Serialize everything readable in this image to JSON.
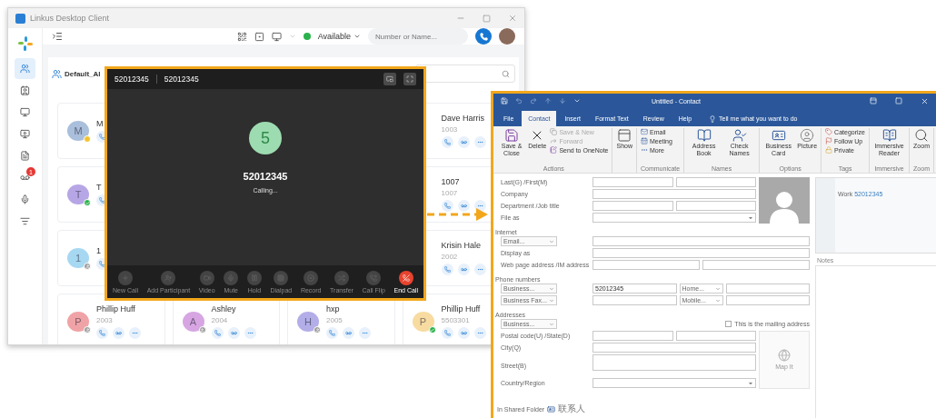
{
  "linkus": {
    "title": "Linkus Desktop Client",
    "sidebar": [
      {
        "selected": true
      },
      {
        "selected": false
      },
      {
        "selected": false
      },
      {
        "selected": false
      },
      {
        "selected": false
      },
      {
        "selected": false,
        "badge": "1"
      },
      {
        "selected": false
      },
      {
        "selected": false
      }
    ],
    "presence": "Available",
    "search": {
      "placeholder": "Number or Name..."
    },
    "directory": {
      "title": "Default_Al"
    },
    "contacts": [
      [
        {
          "initial": "M",
          "name": "M",
          "color": "#a9bfdc",
          "badge": {
            "kind": "away"
          }
        },
        {
          "name": "Dave Harris",
          "ext": "1003"
        }
      ],
      [
        {
          "initial": "T",
          "name": "T",
          "color": "#b7a6e6",
          "badge": {
            "kind": "available"
          }
        },
        {
          "name": "1007",
          "ext": "1007"
        }
      ],
      [
        {
          "initial": "1",
          "name": "1",
          "color": "#a6d8f2",
          "badge": {
            "kind": "offline"
          }
        },
        {
          "name": "Krisin Hale",
          "ext": "2002"
        }
      ],
      [
        {
          "initial": "P",
          "name": "Phillip Huff",
          "ext": "2003",
          "color": "#f0a3a6",
          "badge": {
            "kind": "offline"
          }
        },
        {
          "initial": "A",
          "name": "Ashley",
          "ext": "2004",
          "color": "#d7a6e2",
          "badge": {
            "kind": "offline"
          }
        },
        {
          "initial": "H",
          "name": "hxp",
          "ext": "2005",
          "color": "#b3aee8",
          "badge": {
            "kind": "offline"
          }
        },
        {
          "initial": "P",
          "name": "Phillip Huff",
          "ext": "5503301",
          "color": "#f7dba0",
          "badge": {
            "kind": "available"
          }
        }
      ]
    ]
  },
  "call": {
    "tabs": [
      "52012345",
      "52012345"
    ],
    "avatar": "5",
    "number": "52012345",
    "status": "Calling...",
    "buttons": [
      {
        "label": "New Call",
        "kind": "action",
        "disabled": true
      },
      {
        "label": "Add Participant",
        "kind": "action",
        "disabled": true
      },
      {
        "label": "Video",
        "kind": "action",
        "disabled": true
      },
      {
        "label": "Mute",
        "kind": "action",
        "disabled": true
      },
      {
        "label": "Hold",
        "kind": "action",
        "disabled": true
      },
      {
        "label": "Dialpad",
        "kind": "action",
        "disabled": true
      },
      {
        "label": "Record",
        "kind": "action",
        "disabled": true
      },
      {
        "label": "Transfer",
        "kind": "action",
        "disabled": true
      },
      {
        "label": "Call Flip",
        "kind": "action",
        "disabled": true
      },
      {
        "label": "End Call",
        "kind": "end",
        "disabled": false
      }
    ]
  },
  "outlook": {
    "title": "Untitled - Contact",
    "tabs": [
      {
        "label": "File",
        "selected": false
      },
      {
        "label": "Contact",
        "selected": true
      },
      {
        "label": "Insert",
        "selected": false
      },
      {
        "label": "Format Text",
        "selected": false
      },
      {
        "label": "Review",
        "selected": false
      },
      {
        "label": "Help",
        "selected": false
      }
    ],
    "tell_me": "Tell me what you want to do",
    "ribbon": [
      {
        "label": "Actions",
        "items": [
          {
            "kind": "large",
            "label": "Save & Close",
            "disabled": false
          },
          {
            "kind": "large",
            "label": "Delete",
            "disabled": false
          },
          {
            "kind": "stack",
            "items": [
              {
                "label": "Save & New",
                "disabled": true
              },
              {
                "label": "Forward",
                "disabled": true
              },
              {
                "label": "Send to OneNote",
                "disabled": false
              }
            ]
          }
        ]
      },
      {
        "items": [
          {
            "kind": "large",
            "label": "Show",
            "disabled": false
          }
        ]
      },
      {
        "label": "Communicate",
        "items": [
          {
            "kind": "stack",
            "items": [
              {
                "label": "Email",
                "disabled": false
              },
              {
                "label": "Meeting",
                "disabled": false
              },
              {
                "label": "More",
                "disabled": false
              }
            ]
          }
        ]
      },
      {
        "label": "Names",
        "items": [
          {
            "kind": "large",
            "label": "Address Book",
            "disabled": false
          },
          {
            "kind": "large",
            "label": "Check Names",
            "disabled": false
          }
        ]
      },
      {
        "label": "Options",
        "items": [
          {
            "kind": "large",
            "label": "Business Card",
            "disabled": false
          },
          {
            "kind": "large",
            "label": "Picture",
            "disabled": false
          }
        ]
      },
      {
        "label": "Tags",
        "items": [
          {
            "kind": "stack",
            "items": [
              {
                "label": "Categorize",
                "disabled": false
              },
              {
                "label": "Follow Up",
                "disabled": false
              },
              {
                "label": "Private",
                "disabled": false
              }
            ]
          }
        ]
      },
      {
        "label": "Immersive",
        "items": [
          {
            "kind": "large",
            "label": "Immersive Reader",
            "disabled": false
          }
        ]
      },
      {
        "label": "Zoom",
        "items": [
          {
            "kind": "large",
            "label": "Zoom",
            "disabled": false
          }
        ]
      }
    ],
    "form": [
      {
        "kind": "row",
        "lead": {
          "kind": "label",
          "text": "Last(G) /First(M)"
        },
        "cells": [
          {
            "kind": "text"
          },
          {
            "kind": "text"
          }
        ]
      },
      {
        "kind": "row",
        "lead": {
          "kind": "label",
          "text": "Company"
        },
        "cells": [
          {
            "kind": "text"
          }
        ]
      },
      {
        "kind": "row",
        "lead": {
          "kind": "label",
          "text": "Department /Job title"
        },
        "cells": [
          {
            "kind": "text"
          },
          {
            "kind": "text"
          }
        ]
      },
      {
        "kind": "row",
        "lead": {
          "kind": "label",
          "text": "File as"
        },
        "cells": [
          {
            "kind": "combo"
          }
        ]
      },
      {
        "kind": "heading",
        "text": "Internet"
      },
      {
        "kind": "wide",
        "lead": {
          "kind": "selector",
          "text": "Email..."
        },
        "cells": [
          {
            "kind": "text"
          }
        ]
      },
      {
        "kind": "wide",
        "lead": {
          "kind": "label",
          "text": "Display as"
        },
        "cells": [
          {
            "kind": "text"
          }
        ]
      },
      {
        "kind": "wide",
        "lead": {
          "kind": "label",
          "text": "Web page address /IM address"
        },
        "cells": [
          {
            "kind": "text"
          },
          {
            "kind": "text"
          }
        ]
      },
      {
        "kind": "heading",
        "text": "Phone numbers"
      },
      {
        "kind": "wide",
        "lead": {
          "kind": "selector",
          "text": "Business..."
        },
        "cells": [
          {
            "kind": "text",
            "value": "52012345"
          },
          {
            "kind": "selector",
            "text": "Home..."
          },
          {
            "kind": "text"
          }
        ]
      },
      {
        "kind": "wide",
        "lead": {
          "kind": "selector",
          "text": "Business Fax..."
        },
        "cells": [
          {
            "kind": "text"
          },
          {
            "kind": "selector",
            "text": "Mobile..."
          },
          {
            "kind": "text"
          }
        ]
      },
      {
        "kind": "heading",
        "text": "Addresses"
      },
      {
        "kind": "wide",
        "lead": {
          "kind": "selector",
          "text": "Business..."
        },
        "cells": [
          {
            "kind": "checkbox",
            "text": "This is the mailing address",
            "checked": false
          }
        ]
      },
      {
        "kind": "row",
        "lead": {
          "kind": "label",
          "text": "Postal code(U) /State(D)"
        },
        "cells": [
          {
            "kind": "text"
          },
          {
            "kind": "text"
          }
        ]
      },
      {
        "kind": "row",
        "lead": {
          "kind": "label",
          "text": "City(Q)"
        },
        "cells": [
          {
            "kind": "text"
          }
        ]
      },
      {
        "kind": "row",
        "lead": {
          "kind": "label",
          "text": "Street(B)"
        },
        "cells": [
          {
            "kind": "tall"
          }
        ]
      },
      {
        "kind": "row",
        "lead": {
          "kind": "label",
          "text": "Country/Region"
        },
        "cells": [
          {
            "kind": "combo"
          }
        ]
      }
    ],
    "map_it": "Map It",
    "folder": {
      "label": "In Shared Folder",
      "name": "联系人"
    },
    "card": {
      "label": "Work",
      "value": "52012345"
    },
    "notes": "Notes"
  }
}
